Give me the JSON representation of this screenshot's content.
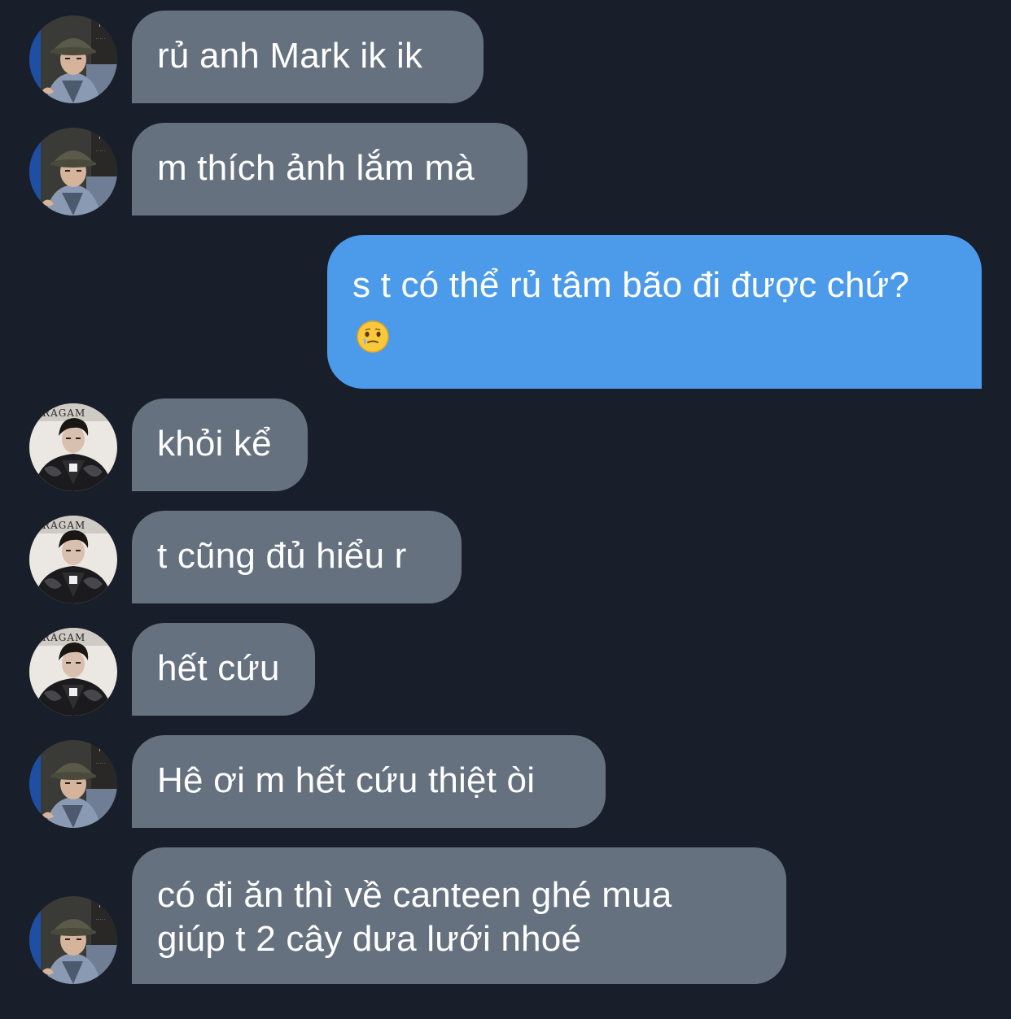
{
  "colors": {
    "background": "#181f2a",
    "incoming_bubble": "#66717f",
    "outgoing_bubble": "#4c9bea",
    "text": "#ffffff"
  },
  "messages": [
    {
      "direction": "incoming",
      "sender_avatar": "avatar-bucket-hat",
      "text": "rủ anh Mark ik ik"
    },
    {
      "direction": "incoming",
      "sender_avatar": "avatar-bucket-hat",
      "text": "m thích ảnh lắm mà"
    },
    {
      "direction": "outgoing",
      "text": "s t có thể rủ tâm bão đi được chứ?",
      "emoji": "face-holding-back-tears"
    },
    {
      "direction": "incoming",
      "sender_avatar": "avatar-leather-jacket",
      "text": "khỏi kể"
    },
    {
      "direction": "incoming",
      "sender_avatar": "avatar-leather-jacket",
      "text": "t cũng đủ hiểu r"
    },
    {
      "direction": "incoming",
      "sender_avatar": "avatar-leather-jacket",
      "text": "hết cứu"
    },
    {
      "direction": "incoming",
      "sender_avatar": "avatar-bucket-hat",
      "text": "Hê ơi m hết cứu thiệt òi"
    },
    {
      "direction": "incoming",
      "sender_avatar": "avatar-bucket-hat",
      "text_lines": [
        "có đi ăn thì về canteen ghé mua",
        "giúp t 2 cây dưa lưới nhoé"
      ]
    }
  ]
}
